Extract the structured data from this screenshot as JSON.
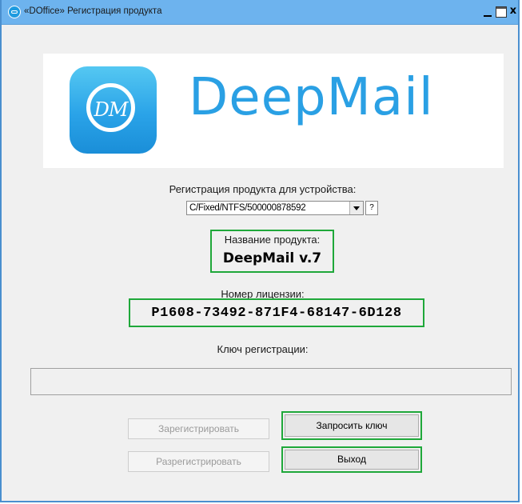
{
  "window": {
    "title": "«DOffice» Регистрация продукта",
    "controls": {
      "minimize": "_",
      "close": "x"
    }
  },
  "logo": {
    "monogram": "DM",
    "wordmark": "DeepMail",
    "brand_color": "#2aa0e4"
  },
  "device": {
    "label": "Регистрация продукта для устройства:",
    "selected": "C/Fixed/NTFS/500000878592",
    "help": "?"
  },
  "product": {
    "label": "Название продукта:",
    "name": "DeepMail v.7"
  },
  "license": {
    "label": "Номер лицензии:",
    "number": "P1608-73492-871F4-68147-6D128"
  },
  "registration_key": {
    "label": "Ключ регистрации:",
    "value": ""
  },
  "buttons": {
    "register": "Зарегистрировать",
    "unregister": "Разрегистрировать",
    "request_key": "Запросить ключ",
    "exit": "Выход"
  },
  "highlight_color": "#1fa83a"
}
